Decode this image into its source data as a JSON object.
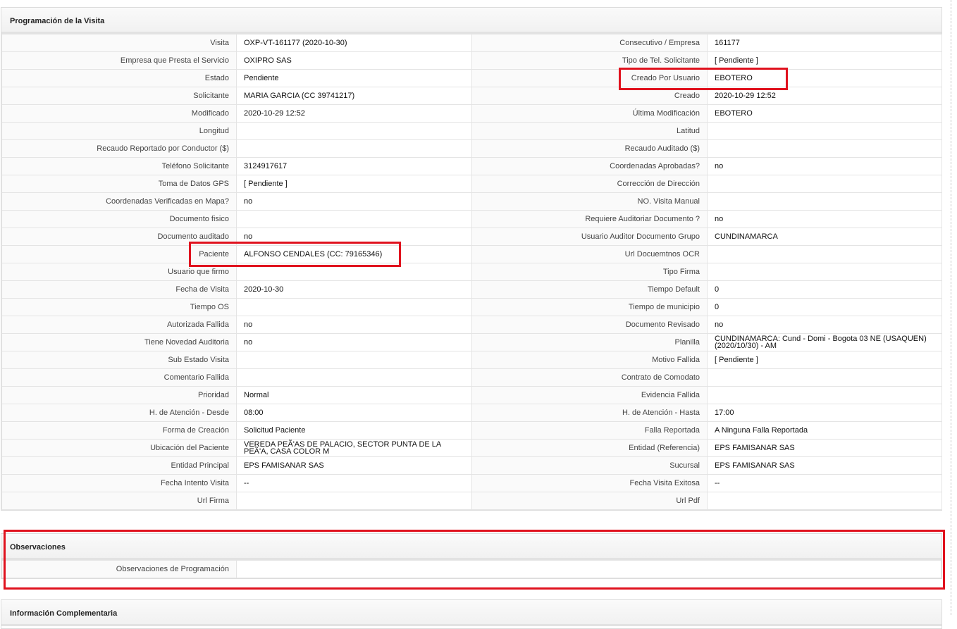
{
  "programacion": {
    "title": "Programación de la Visita",
    "rows": [
      {
        "l1": "Visita",
        "v1": "OXP-VT-161177 (2020-10-30)",
        "l2": "Consecutivo / Empresa",
        "v2": "161177"
      },
      {
        "l1": "Empresa que Presta el Servicio",
        "v1": "OXIPRO SAS",
        "l2": "Tipo de Tel. Solicitante",
        "v2": "[ Pendiente ]"
      },
      {
        "l1": "Estado",
        "v1": "Pendiente",
        "l2": "Creado Por Usuario",
        "v2": "EBOTERO"
      },
      {
        "l1": "Solicitante",
        "v1": "MARIA GARCIA (CC 39741217)",
        "l2": "Creado",
        "v2": "2020-10-29 12:52"
      },
      {
        "l1": "Modificado",
        "v1": "2020-10-29 12:52",
        "l2": "Última Modificación",
        "v2": " EBOTERO"
      },
      {
        "l1": "Longitud",
        "v1": "",
        "l2": "Latitud",
        "v2": ""
      },
      {
        "l1": "Recaudo Reportado por Conductor ($)",
        "v1": "",
        "l2": "Recaudo Auditado ($)",
        "v2": ""
      },
      {
        "l1": "Teléfono Solicitante",
        "v1": "3124917617",
        "l2": "Coordenadas Aprobadas?",
        "v2": " no"
      },
      {
        "l1": "Toma de Datos GPS",
        "v1": "[ Pendiente ]",
        "l2": "Corrección de Dirección",
        "v2": ""
      },
      {
        "l1": "Coordenadas Verificadas en Mapa?",
        "v1": " no",
        "l2": "NO. Visita Manual",
        "v2": ""
      },
      {
        "l1": "Documento fisico",
        "v1": "",
        "l2": "Requiere Auditoriar Documento ?",
        "v2": " no"
      },
      {
        "l1": "Documento auditado",
        "v1": " no",
        "l2": "Usuario Auditor Documento Grupo",
        "v2": "CUNDINAMARCA"
      },
      {
        "l1": "Paciente",
        "v1": "ALFONSO CENDALES (CC: 79165346)",
        "l2": "Url Docuemtnos OCR",
        "v2": ""
      },
      {
        "l1": "Usuario que firmo",
        "v1": "",
        "l2": "Tipo Firma",
        "v2": ""
      },
      {
        "l1": "Fecha de Visita",
        "v1": " 2020-10-30",
        "l2": "Tiempo Default",
        "v2": "0"
      },
      {
        "l1": "Tiempo OS",
        "v1": "",
        "l2": "Tiempo de municipio",
        "v2": "0"
      },
      {
        "l1": "Autorizada Fallida",
        "v1": " no",
        "l2": "Documento Revisado",
        "v2": " no"
      },
      {
        "l1": "Tiene Novedad Auditoria",
        "v1": " no",
        "l2": "Planilla",
        "v2": "CUNDINAMARCA: Cund - Domi - Bogota 03 NE (USAQUEN) (2020/10/30) - AM"
      },
      {
        "l1": "Sub Estado Visita",
        "v1": "",
        "l2": "Motivo Fallida",
        "v2": "[ Pendiente ]"
      },
      {
        "l1": "Comentario Fallida",
        "v1": "",
        "l2": "Contrato de Comodato",
        "v2": ""
      },
      {
        "l1": "Prioridad",
        "v1": "Normal",
        "l2": "Evidencia Fallida",
        "v2": ""
      },
      {
        "l1": "H. de Atención - Desde",
        "v1": "08:00",
        "l2": "H. de Atención - Hasta",
        "v2": " 17:00"
      },
      {
        "l1": "Forma de Creación",
        "v1": "Solicitud Paciente",
        "l2": "Falla Reportada",
        "v2": "A Ninguna Falla Reportada"
      },
      {
        "l1": "Ubicación del Paciente",
        "v1": "VEREDA PEÃ'AS DE PALACIO, SECTOR PUNTA DE LA PEÃ'A, CASA COLOR M",
        "l2": "Entidad (Referencia)",
        "v2": "EPS FAMISANAR SAS"
      },
      {
        "l1": "Entidad Principal",
        "v1": "EPS FAMISANAR SAS",
        "l2": "Sucursal",
        "v2": "EPS FAMISANAR SAS"
      },
      {
        "l1": "Fecha Intento Visita",
        "v1": " --",
        "l2": "Fecha Visita Exitosa",
        "v2": " --"
      },
      {
        "l1": "Url Firma",
        "v1": "",
        "l2": "Url Pdf",
        "v2": ""
      }
    ]
  },
  "observaciones": {
    "title": "Observaciones",
    "label": "Observaciones de Programación",
    "value": ""
  },
  "complementaria": {
    "title": "Información Complementaria"
  }
}
